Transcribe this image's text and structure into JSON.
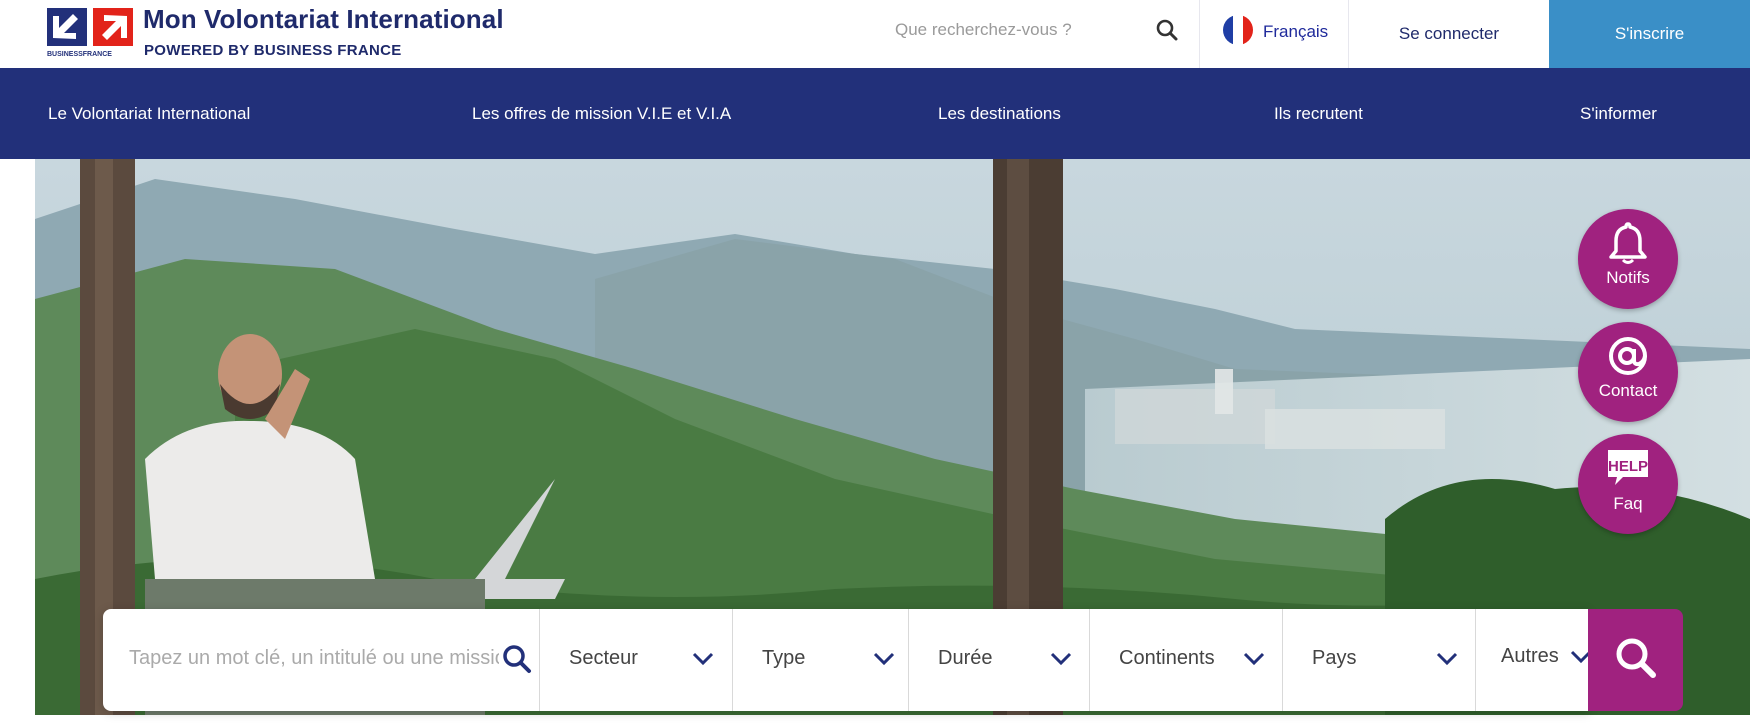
{
  "header": {
    "brand_title": "Mon Volontariat International",
    "brand_subtitle": "POWERED BY BUSINESS FRANCE",
    "search_placeholder": "Que recherchez-vous ?",
    "language": "Français",
    "login_label": "Se connecter",
    "signup_label": "S'inscrire"
  },
  "nav": {
    "items": [
      {
        "label": "Le Volontariat International"
      },
      {
        "label": "Les offres de mission V.I.E et V.I.A"
      },
      {
        "label": "Les destinations"
      },
      {
        "label": "Ils recrutent"
      },
      {
        "label": "S'informer"
      }
    ]
  },
  "floating_actions": [
    {
      "label": "Notifs",
      "icon": "bell-icon"
    },
    {
      "label": "Contact",
      "icon": "at-sign-icon"
    },
    {
      "label": "Faq",
      "icon": "help-bubble-icon"
    }
  ],
  "search": {
    "keyword_placeholder": "Tapez un mot clé, un intitulé ou une missio",
    "filters": [
      {
        "label": "Secteur"
      },
      {
        "label": "Type"
      },
      {
        "label": "Durée"
      },
      {
        "label": "Continents"
      },
      {
        "label": "Pays"
      },
      {
        "label": "Autres"
      }
    ]
  },
  "colors": {
    "navy": "#22307a",
    "signup_blue": "#3a8fc7",
    "magenta": "#a0227f",
    "logo_red": "#e2231a"
  }
}
